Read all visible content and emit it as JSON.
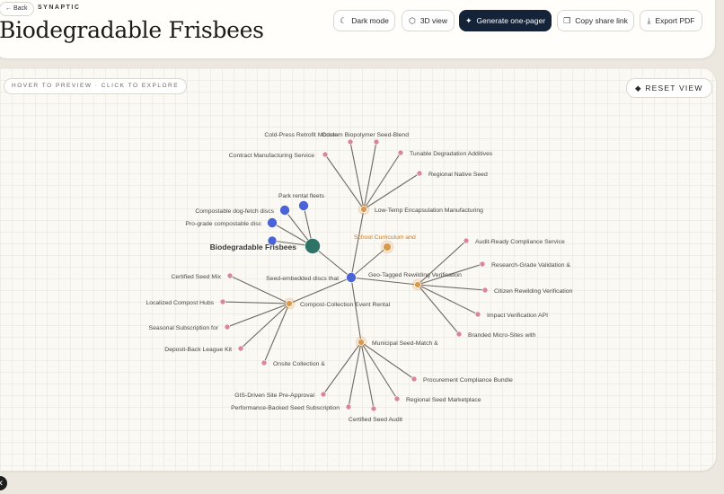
{
  "header": {
    "back_label": "Back",
    "brand": "SYNAPTIC",
    "title": "Biodegradable Frisbees",
    "buttons": {
      "dark_mode": "Dark mode",
      "view_3d": "3D view",
      "one_pager": "Generate one-pager",
      "share": "Copy share link",
      "export": "Export PDF"
    }
  },
  "canvas": {
    "hint": "HOVER TO PREVIEW · CLICK TO EXPLORE",
    "reset_label": "RESET VIEW"
  },
  "colors": {
    "root": "#2e7466",
    "blue": "#4a63d6",
    "orange": "#d9984a",
    "pink": "#d98797",
    "edge": "#55514b",
    "primary_button": "#152338"
  },
  "graph": {
    "root": {
      "label": "Biodegradable Frisbees"
    },
    "hub": {
      "label": "Seed-embedded discs that"
    },
    "categories": [
      {
        "id": "low_temp",
        "label": "Low-Temp Encapsulation Manufacturing",
        "children": [
          "Cold-Press Retrofit Module",
          "Custom Biopolymer Seed-Blend",
          "Contract Manufacturing Service",
          "Tunable Degradation Additives",
          "Regional Native Seed"
        ]
      },
      {
        "id": "geo",
        "label": "Geo-Tagged Rewilding Verification",
        "children": [
          "Audit-Ready Compliance Service",
          "Research-Grade Validation &",
          "Citizen Rewilding Verification",
          "Impact Verification API",
          "Branded Micro-Sites with"
        ]
      },
      {
        "id": "compost",
        "label": "Compost-Collection Event Rental",
        "children": [
          "Certified Seed Mix",
          "Localized Compost Hubs",
          "Seasonal Subscription for",
          "Deposit-Back League Kit",
          "Onsite Collection &"
        ]
      },
      {
        "id": "municipal",
        "label": "Municipal Seed-Match &",
        "children": [
          "Procurement Compliance Bundle",
          "Regional Seed Marketplace",
          "Certified Seed Audit",
          "Performance-Backed Seed Subscription",
          "GIS-Driven Site Pre-Approval"
        ]
      },
      {
        "id": "school",
        "label": "School Curriculum and",
        "children": []
      }
    ],
    "root_children": [
      "Park rental fleets",
      "Compostable dog-fetch discs",
      "Pro-grade compostable disc"
    ]
  }
}
